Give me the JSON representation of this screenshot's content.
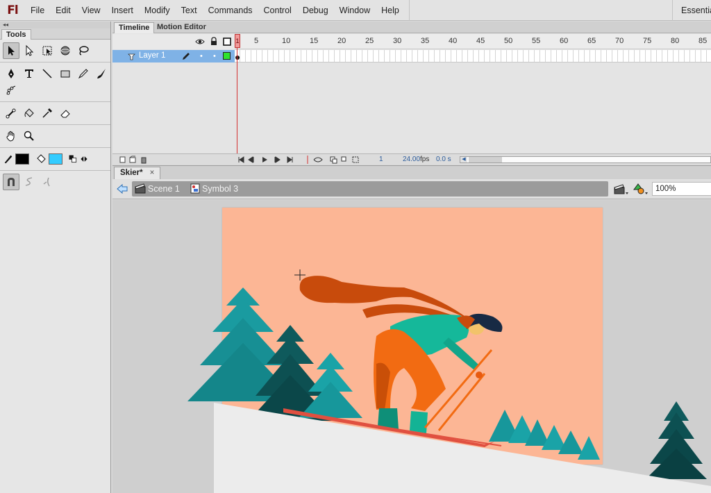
{
  "app": {
    "logo": "Fl",
    "workspace": "Essentials"
  },
  "menu": [
    "File",
    "Edit",
    "View",
    "Insert",
    "Modify",
    "Text",
    "Commands",
    "Control",
    "Debug",
    "Window",
    "Help"
  ],
  "tools": {
    "panel_title": "Tools",
    "stroke_color": "#000000",
    "fill_color": "#33ccff"
  },
  "timeline": {
    "tabs": [
      "Timeline",
      "Motion Editor"
    ],
    "layer_name": "Layer 1",
    "frame_numbers": [
      "1",
      "5",
      "10",
      "15",
      "20",
      "25",
      "30",
      "35",
      "40",
      "45",
      "50",
      "55",
      "60",
      "65",
      "70",
      "75",
      "80",
      "85"
    ],
    "current_frame": "1",
    "fps": "24.00",
    "fps_unit": "fps",
    "time": "0.0 s"
  },
  "document": {
    "tab_title": "Skier*",
    "close": "×",
    "breadcrumbs": [
      {
        "label": "Scene 1"
      },
      {
        "label": "Symbol 3"
      }
    ],
    "zoom": "100%"
  },
  "colors": {
    "stage_bg": "#fcb695",
    "accent_selection": "#7fb2e6",
    "playhead": "#d43030"
  }
}
